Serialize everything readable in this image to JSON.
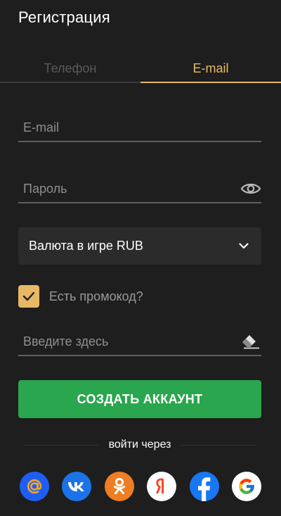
{
  "header": {
    "title": "Регистрация"
  },
  "tabs": [
    {
      "label": "Телефон",
      "active": false
    },
    {
      "label": "E-mail",
      "active": true
    }
  ],
  "form": {
    "email": {
      "placeholder": "E-mail",
      "value": ""
    },
    "password": {
      "placeholder": "Пароль",
      "value": "",
      "toggle_icon": "eye-icon"
    },
    "currency": {
      "selected": "Валюта в игре RUB",
      "icon": "chevron-down-icon"
    },
    "promo": {
      "label": "Есть промокод?",
      "checked": true,
      "icon": "check-icon"
    },
    "promo_code": {
      "placeholder": "Введите здесь",
      "value": "",
      "clear_icon": "eraser-icon"
    },
    "submit_label": "СОЗДАТЬ АККАУНТ"
  },
  "social": {
    "divider_text": "войти через",
    "providers": [
      {
        "name": "mail-ru",
        "icon": "at-icon",
        "color": "#1f5ef5"
      },
      {
        "name": "vk",
        "icon": "vk-icon",
        "color": "#1c73e8"
      },
      {
        "name": "odnoklassniki",
        "icon": "ok-icon",
        "color": "#ee7e23"
      },
      {
        "name": "yandex",
        "icon": "yandex-icon",
        "color": "#ffffff"
      },
      {
        "name": "facebook",
        "icon": "facebook-icon",
        "color": "#1877f2"
      },
      {
        "name": "google",
        "icon": "google-icon",
        "color": "#ffffff"
      }
    ]
  },
  "colors": {
    "background": "#1e1e1e",
    "accent": "#e8b867",
    "button": "#2aa64e",
    "field_line": "#5f5f5f",
    "select_bg": "#2b2b2b"
  }
}
